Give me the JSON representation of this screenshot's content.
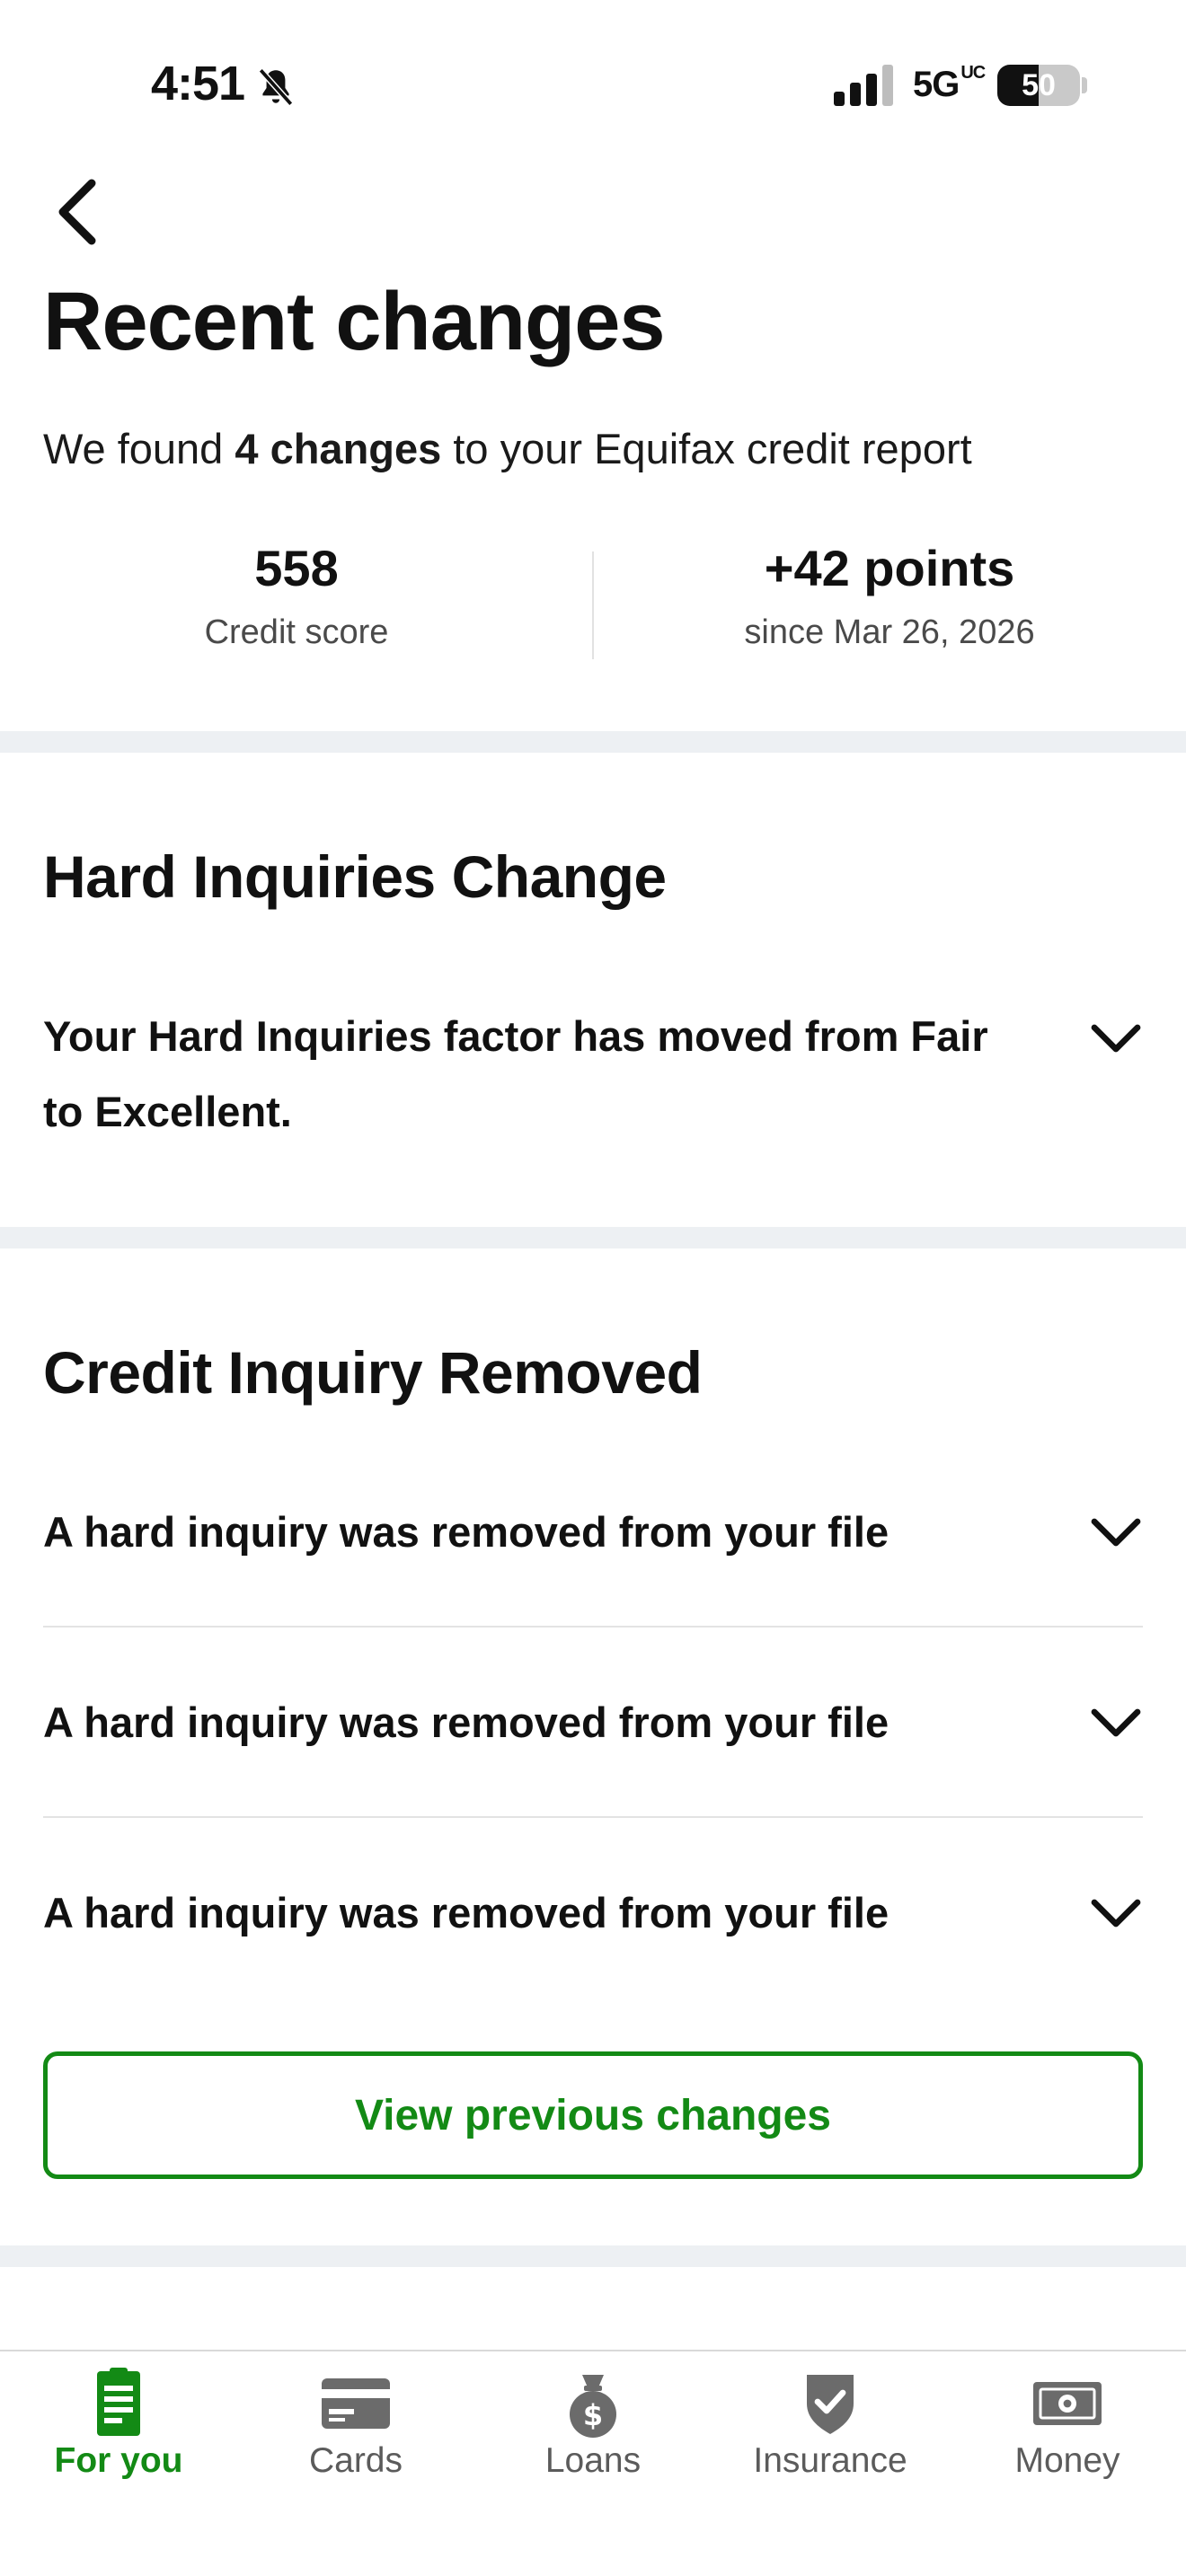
{
  "status_bar": {
    "time": "4:51",
    "network": "5G",
    "network_sup": "UC",
    "battery": "50",
    "battery_level": 0.5
  },
  "header": {
    "title": "Recent changes",
    "subtitle_prefix": "We found ",
    "subtitle_bold": "4 changes",
    "subtitle_suffix": " to your Equifax credit report"
  },
  "stats": {
    "score_value": "558",
    "score_label": "Credit score",
    "change_value": "+42 points",
    "change_label": "since Mar 26, 2026"
  },
  "sections": {
    "hard_inquiries": {
      "title": "Hard Inquiries Change",
      "item": "Your Hard Inquiries factor has moved from Fair to Excellent."
    },
    "credit_inquiry_removed": {
      "title": "Credit Inquiry Removed",
      "items": [
        "A hard inquiry was removed from your file",
        "A hard inquiry was removed from your file",
        "A hard inquiry was removed from your file"
      ]
    }
  },
  "actions": {
    "view_previous": "View previous changes"
  },
  "bottom_nav": {
    "items": [
      {
        "label": "For you",
        "icon": "document-icon",
        "active": true
      },
      {
        "label": "Cards",
        "icon": "card-icon",
        "active": false
      },
      {
        "label": "Loans",
        "icon": "money-bag-icon",
        "active": false
      },
      {
        "label": "Insurance",
        "icon": "shield-icon",
        "active": false
      },
      {
        "label": "Money",
        "icon": "cash-icon",
        "active": false
      }
    ]
  },
  "colors": {
    "accent_green": "#138a15",
    "separator": "#edf0f3",
    "nav_inactive": "#5b5b5b"
  }
}
